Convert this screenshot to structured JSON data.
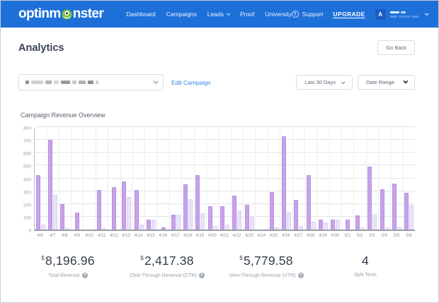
{
  "brand": {
    "logo_prefix": "optinm",
    "logo_suffix": "nster"
  },
  "nav": {
    "items": [
      {
        "label": "Dashboard",
        "dropdown": false
      },
      {
        "label": "Campaigns",
        "dropdown": false
      },
      {
        "label": "Leads",
        "dropdown": true
      },
      {
        "label": "Proof",
        "dropdown": false
      },
      {
        "label": "University",
        "dropdown": false
      }
    ],
    "support_label": "Support",
    "upgrade_label": "UPGRADE",
    "avatar_letter": "A",
    "user_name_redacted": true
  },
  "page": {
    "title": "Analytics",
    "go_back_label": "Go Back",
    "campaign_select_redacted": true,
    "edit_campaign_label": "Edit Campaign",
    "last_30_days_label": "Last 30 Days",
    "date_range_label": "Date Range",
    "section_title": "Campaign Revenue Overview"
  },
  "stats": [
    {
      "currency": "$",
      "value": "8,196.96",
      "label": "Total Revenue",
      "info_icon": true
    },
    {
      "currency": "$",
      "value": "2,417.38",
      "label": "Click-Through Revenue (CTR)",
      "info_icon": true
    },
    {
      "currency": "$",
      "value": "5,779.58",
      "label": "View-Through Revenue (VTR)",
      "info_icon": true
    },
    {
      "currency": "",
      "value": "4",
      "label": "Split Tests",
      "info_icon": false
    }
  ],
  "colors": {
    "header_blue": "#1e70d9",
    "accent_link": "#3285e0",
    "bar_primary": "#c6a3e9",
    "bar_secondary": "#e8e3f9",
    "logo_monster_green": "#7ac143"
  },
  "chart_data": {
    "type": "bar",
    "title": "Campaign Revenue Overview",
    "categories": [
      "4/6",
      "4/7",
      "4/8",
      "4/9",
      "4/10",
      "4/11",
      "4/12",
      "4/13",
      "4/14",
      "4/15",
      "4/16",
      "4/17",
      "4/18",
      "4/19",
      "4/20",
      "4/21",
      "4/22",
      "4/23",
      "4/24",
      "4/25",
      "4/26",
      "4/27",
      "4/28",
      "4/29",
      "4/30",
      "5/1",
      "5/2",
      "5/3",
      "5/4",
      "5/5",
      "5/6"
    ],
    "series": [
      {
        "name": "dark-purple",
        "color": "#c6a3e9",
        "values": [
          425,
          700,
          200,
          135,
          0,
          310,
          330,
          375,
          310,
          80,
          15,
          115,
          355,
          425,
          180,
          180,
          265,
          195,
          0,
          290,
          730,
          230,
          425,
          80,
          80,
          75,
          110,
          490,
          315,
          360,
          285
        ]
      },
      {
        "name": "light-lavender",
        "color": "#e8e3f9",
        "values": [
          40,
          270,
          10,
          0,
          0,
          10,
          0,
          255,
          40,
          80,
          0,
          115,
          235,
          125,
          30,
          40,
          150,
          100,
          0,
          15,
          140,
          30,
          60,
          55,
          80,
          0,
          15,
          120,
          15,
          20,
          195
        ]
      }
    ],
    "xlabel": "",
    "ylabel": "",
    "ylim": [
      0,
      800
    ],
    "ytick_step": 100,
    "grid": true,
    "legend": false
  }
}
